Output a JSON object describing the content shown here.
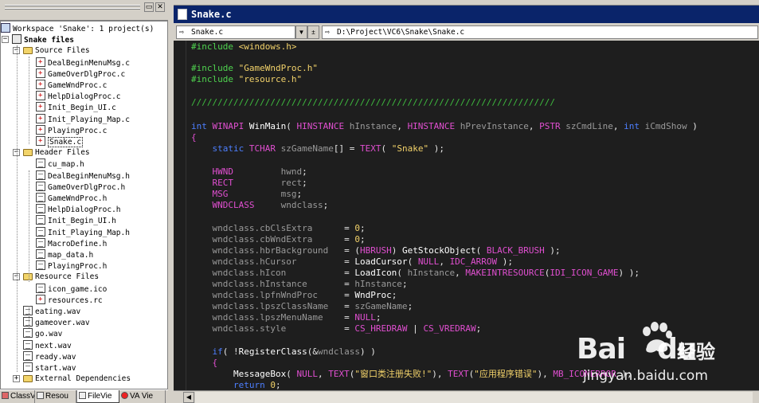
{
  "workspace": {
    "title": "Workspace 'Snake': 1 project(s)",
    "project": "Snake files",
    "folders": [
      {
        "name": "Source Files",
        "files": [
          "DealBeginMenuMsg.c",
          "GameOverDlgProc.c",
          "GameWndProc.c",
          "HelpDialogProc.c",
          "Init_Begin_UI.c",
          "Init_Playing_Map.c",
          "PlayingProc.c",
          "Snake.c"
        ]
      },
      {
        "name": "Header Files",
        "files": [
          "cu_map.h",
          "DealBeginMenuMsg.h",
          "GameOverDlgProc.h",
          "GameWndProc.h",
          "HelpDialogProc.h",
          "Init_Begin_UI.h",
          "Init_Playing_Map.h",
          "MacroDefine.h",
          "map_data.h",
          "PlayingProc.h"
        ]
      },
      {
        "name": "Resource Files",
        "files": [
          "icon_game.ico",
          "resources.rc"
        ]
      }
    ],
    "loose_files": [
      "eating.wav",
      "gameover.wav",
      "go.wav",
      "next.wav",
      "ready.wav",
      "start.wav"
    ],
    "external": "External Dependencies",
    "selected": "Snake.c"
  },
  "tabs": [
    "ClassV",
    "Resou",
    "FileVie",
    "VA Vie"
  ],
  "editor": {
    "title": "Snake.c",
    "combo_file": "Snake.c",
    "combo_path": "D:\\Project\\VC6\\Snake\\Snake.c"
  },
  "watermark": {
    "brand": "Bai",
    "brand_suffix": "du",
    "cn": "经验",
    "url": "jingyan.baidu.com"
  },
  "colors": {
    "title_bar": "#0a246a",
    "editor_bg": "#1e1e1e",
    "preprocessor": "#4fd34f",
    "keyword": "#4d7fff",
    "macro": "#e04fd0",
    "string": "#f2d26a"
  }
}
